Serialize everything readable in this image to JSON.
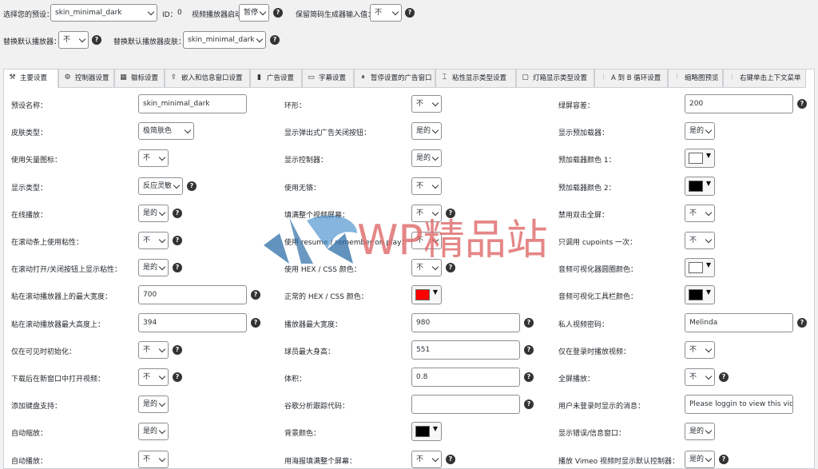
{
  "top": {
    "preset_label": "选择您的预设：",
    "preset_value": "skin_minimal_dark",
    "id_label": "ID：",
    "id_value": "0",
    "autoplay_behavior_label": "视频播放器启动行为：",
    "autoplay_behavior_value": "暂停",
    "keep_shortcode_label": "保留简码生成器输入值：",
    "keep_shortcode_value": "不",
    "replace_default_player_label": "替换默认播放器：",
    "replace_default_player_value": "不",
    "replace_default_skin_label": "替换默认播放器皮肤：",
    "replace_default_skin_value": "skin_minimal_dark"
  },
  "tabs": [
    {
      "label": "主要设置",
      "icon": "wrench-icon"
    },
    {
      "label": "控制器设置",
      "icon": "gear-icon"
    },
    {
      "label": "徽标设置",
      "icon": "logo-icon"
    },
    {
      "label": "嵌入和信息窗口设置",
      "icon": "share-icon"
    },
    {
      "label": "广告设置",
      "icon": "ad-icon"
    },
    {
      "label": "字幕设置",
      "icon": "subtitle-icon"
    },
    {
      "label": "暂停设置的广告窗口",
      "icon": "pause-icon"
    },
    {
      "label": "粘性显示类型设置",
      "icon": "sticky-icon"
    },
    {
      "label": "灯箱显示类型设置",
      "icon": "lightbox-icon"
    },
    {
      "label": "A 到 B 循环设置",
      "icon": "sliders-icon"
    },
    {
      "label": "缩略图预览",
      "icon": "sliders-icon"
    },
    {
      "label": "右键单击上下文菜单",
      "icon": "sliders-icon"
    }
  ],
  "col1": [
    {
      "label": "预设名称：",
      "type": "input",
      "value": "skin_minimal_dark"
    },
    {
      "label": "皮肤类型：",
      "type": "select",
      "value": "极简肤色"
    },
    {
      "label": "使用矢量图标：",
      "type": "select",
      "value": "不"
    },
    {
      "label": "显示类型：",
      "type": "select",
      "value": "反应灵敏",
      "help": true
    },
    {
      "label": "在线播放：",
      "type": "select",
      "value": "是的",
      "help": true
    },
    {
      "label": "在滚动条上使用粘性：",
      "type": "select",
      "value": "不",
      "help": true
    },
    {
      "label": "在滚动打开/关闭按钮上显示粘性：",
      "type": "select",
      "value": "是的",
      "help": true
    },
    {
      "label": "粘在滚动播放器上的最大宽度：",
      "type": "input",
      "value": "700",
      "help": true
    },
    {
      "label": "粘在滚动播放器最大高度上：",
      "type": "input",
      "value": "394",
      "help": true
    },
    {
      "label": "仅在可见时初始化：",
      "type": "select",
      "value": "不",
      "help": true
    },
    {
      "label": "下载后在新窗口中打开视频：",
      "type": "select",
      "value": "不",
      "help": true
    },
    {
      "label": "添加键盘支持：",
      "type": "select",
      "value": "是的"
    },
    {
      "label": "自动缩放：",
      "type": "select",
      "value": "是的"
    },
    {
      "label": "自动播放：",
      "type": "select",
      "value": "不"
    }
  ],
  "col2": [
    {
      "label": "环形：",
      "type": "select",
      "value": "不"
    },
    {
      "label": "显示弹出式广告关闭按钮：",
      "type": "select",
      "value": "是的"
    },
    {
      "label": "显示控制器：",
      "type": "select",
      "value": "是的"
    },
    {
      "label": "使用无铬：",
      "type": "select",
      "value": "不"
    },
    {
      "label": "填满整个视频屏幕：",
      "type": "select",
      "value": "不",
      "help": true
    },
    {
      "label": "使用 resume / remember on play：",
      "type": "select",
      "value": "不"
    },
    {
      "label": "使用 HEX / CSS 颜色：",
      "type": "select",
      "value": "不",
      "help": true
    },
    {
      "label": "正常的 HEX / CSS 颜色：",
      "type": "color",
      "value": "#ff0000"
    },
    {
      "label": "播放器最大宽度：",
      "type": "input",
      "value": "980",
      "help": true
    },
    {
      "label": "球员最大身高：",
      "type": "input",
      "value": "551",
      "help": true
    },
    {
      "label": "体积：",
      "type": "input",
      "value": "0.8",
      "help": true
    },
    {
      "label": "谷歌分析跟踪代码：",
      "type": "input",
      "value": "",
      "help": true
    },
    {
      "label": "背景颜色：",
      "type": "color",
      "value": "#000000"
    },
    {
      "label": "用海报填满整个屏幕：",
      "type": "select",
      "value": "不",
      "help": true
    }
  ],
  "col3": [
    {
      "label": "绿屏容差：",
      "type": "input",
      "value": "200",
      "help": true
    },
    {
      "label": "显示预加载器：",
      "type": "select",
      "value": "是的"
    },
    {
      "label": "预加载器颜色 1：",
      "type": "color",
      "value": "#ffffff"
    },
    {
      "label": "预加载器颜色 2：",
      "type": "color",
      "value": "#000000"
    },
    {
      "label": "禁用双击全屏：",
      "type": "select",
      "value": "不"
    },
    {
      "label": "只调用 cupoints 一次：",
      "type": "select",
      "value": "不"
    },
    {
      "label": "音频可视化器圆圈颜色：",
      "type": "color",
      "value": "#ffffff"
    },
    {
      "label": "音频可视化工具栏颜色：",
      "type": "color",
      "value": "#000000"
    },
    {
      "label": "私人视频密码：",
      "type": "input",
      "value": "Melinda",
      "help": true
    },
    {
      "label": "仅在登录时播放视频：",
      "type": "select",
      "value": "不"
    },
    {
      "label": "全屏播放：",
      "type": "select",
      "value": "不",
      "help": true
    },
    {
      "label": "用户未登录时显示的消息：",
      "type": "input",
      "value": "Please loggin to view this video"
    },
    {
      "label": "显示错误/信息窗口：",
      "type": "select",
      "value": "是的"
    },
    {
      "label": "播放 Vimeo 视频时显示默认控制器：",
      "type": "select",
      "value": "是的",
      "help": true
    }
  ],
  "watermark": {
    "text": "WP精品站",
    "color": "#e06a6a",
    "logo_color": "#2d6ea8"
  }
}
